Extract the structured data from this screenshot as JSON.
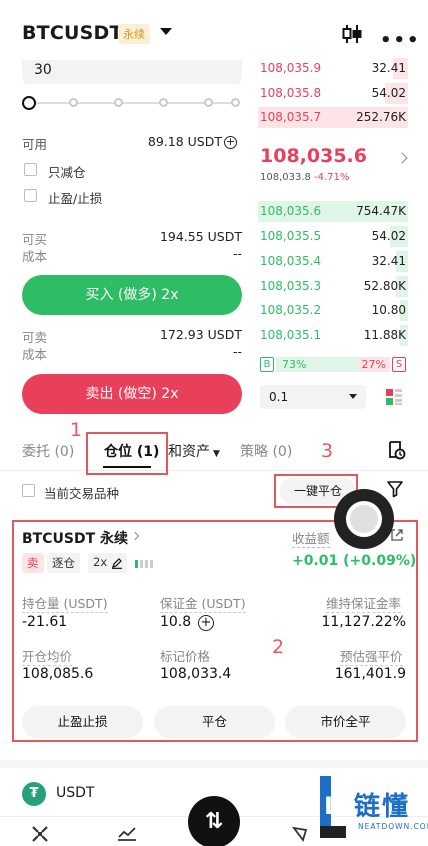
{
  "header": {
    "symbol": "BTCUSDT",
    "contract_type": "永续"
  },
  "order_form": {
    "quantity": "30",
    "available_label": "可用",
    "available_value": "89.18 USDT",
    "reduce_only_label": "只减仓",
    "tp_sl_label": "止盈/止损",
    "buy": {
      "max_label": "可买",
      "max_value": "194.55 USDT",
      "cost_label": "成本",
      "cost_value": "--",
      "button": "买入 (做多) 2x"
    },
    "sell": {
      "max_label": "可卖",
      "max_value": "172.93 USDT",
      "cost_label": "成本",
      "cost_value": "--",
      "button": "卖出 (做空) 2x"
    }
  },
  "order_book": {
    "asks": [
      {
        "price": "108,035.9",
        "qty": "32.41",
        "depth": 0.1
      },
      {
        "price": "108,035.8",
        "qty": "54.02",
        "depth": 0.15
      },
      {
        "price": "108,035.7",
        "qty": "252.76K",
        "depth": 1.0
      }
    ],
    "last_price": "108,035.6",
    "mark_price": "108,033.8",
    "change_pct": "-4.71%",
    "bids": [
      {
        "price": "108,035.6",
        "qty": "754.47K",
        "depth": 1.0
      },
      {
        "price": "108,035.5",
        "qty": "54.02",
        "depth": 0.12
      },
      {
        "price": "108,035.4",
        "qty": "32.41",
        "depth": 0.08
      },
      {
        "price": "108,035.3",
        "qty": "52.80K",
        "depth": 0.08
      },
      {
        "price": "108,035.2",
        "qty": "10.80",
        "depth": 0.05
      },
      {
        "price": "108,035.1",
        "qty": "11.88K",
        "depth": 0.05
      }
    ],
    "buy_ratio_label": "B",
    "buy_ratio": "73%",
    "sell_ratio": "27%",
    "sell_ratio_label": "S",
    "step": "0.1"
  },
  "tabs": [
    {
      "label": "委托 (0)"
    },
    {
      "label": "仓位 (1)"
    },
    {
      "label": "和资产"
    },
    {
      "label": "策略 (0)"
    }
  ],
  "annotations": {
    "n1": "1",
    "n2": "2",
    "n3": "3"
  },
  "positions_filter": {
    "current_symbol_label": "当前交易品种",
    "close_all": "一键平仓"
  },
  "position": {
    "title": "BTCUSDT 永续",
    "side": "卖",
    "margin_mode": "逐仓",
    "leverage": "2x",
    "pnl_label": "收益额",
    "pnl_value": "+0.01 (+0.09%)",
    "fields": [
      {
        "label": "持仓量 (USDT)",
        "value": "-21.61"
      },
      {
        "label": "保证金 (USDT)",
        "value": "10.8"
      },
      {
        "label": "维持保证金率",
        "value": "11,127.22%"
      },
      {
        "label": "开仓均价",
        "value": "108,085.6"
      },
      {
        "label": "标记价格",
        "value": "108,033.4"
      },
      {
        "label": "预估强平价",
        "value": "161,401.9"
      }
    ],
    "buttons": {
      "tp_sl": "止盈止损",
      "close": "平仓",
      "market_close": "市价全平"
    }
  },
  "assets": {
    "coin": "USDT"
  },
  "watermark": {
    "text": "链懂",
    "sub": "NEATDOWN.COM",
    "letter": "L"
  },
  "colors": {
    "buy": "#2ebd64",
    "sell": "#e8405a",
    "annotation": "#e5575c",
    "perp_badge": "#c99a1b"
  }
}
